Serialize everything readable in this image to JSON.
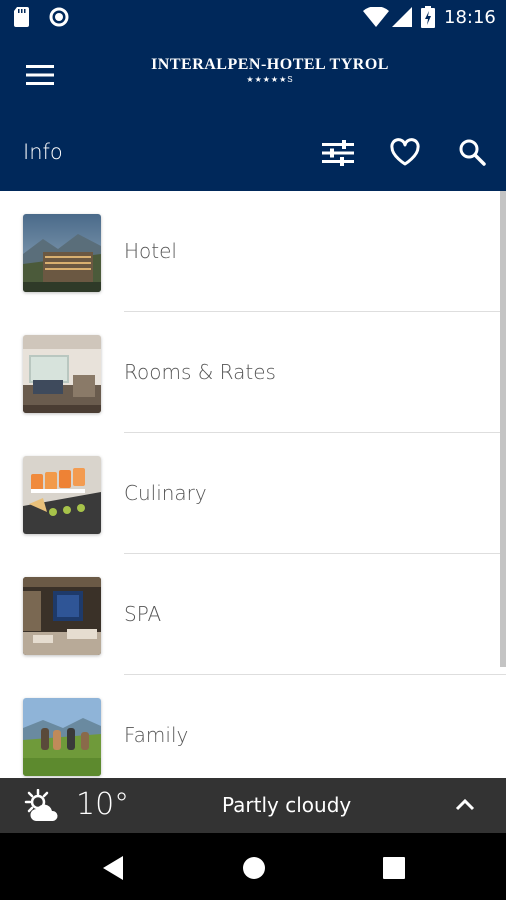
{
  "status": {
    "time": "18:16"
  },
  "header": {
    "brand_name": "INTERALPEN-HOTEL TYROL",
    "brand_stars": "★★★★★S",
    "title": "Info"
  },
  "list": [
    {
      "label": "Hotel"
    },
    {
      "label": "Rooms & Rates"
    },
    {
      "label": "Culinary"
    },
    {
      "label": "SPA"
    },
    {
      "label": "Family"
    }
  ],
  "weather": {
    "temperature": "10°",
    "condition": "Partly cloudy"
  },
  "colors": {
    "primary": "#00285a",
    "weather_bar": "#333333",
    "nav_bar": "#000000"
  }
}
